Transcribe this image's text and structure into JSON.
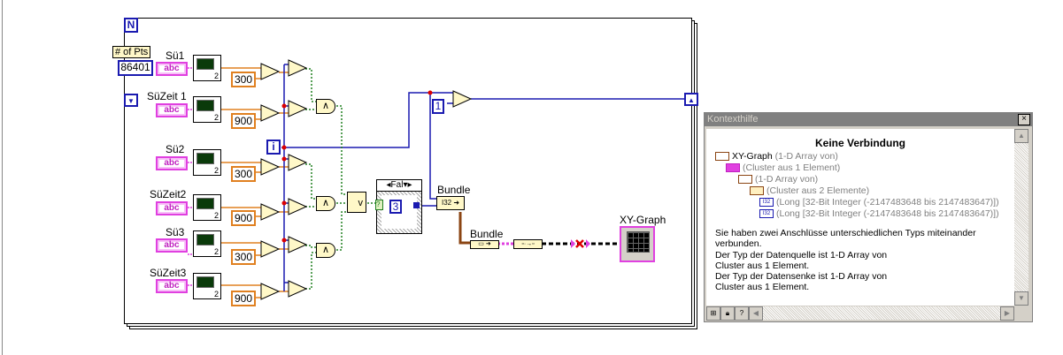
{
  "diagram": {
    "loop_count_terminal": "N",
    "iteration_terminal": "i",
    "num_points": {
      "label": "# of Pts",
      "value": "86401"
    },
    "rows": [
      {
        "label": "Sü1",
        "string_const": "abc",
        "subvi_num": "2",
        "offset": "300"
      },
      {
        "label": "SüZeit 1",
        "string_const": "abc",
        "subvi_num": "2",
        "offset": "900"
      },
      {
        "label": "Sü2",
        "string_const": "abc",
        "subvi_num": "2",
        "offset": "300"
      },
      {
        "label": "SüZeit2",
        "string_const": "abc",
        "subvi_num": "2",
        "offset": "900"
      },
      {
        "label": "Sü3",
        "string_const": "abc",
        "subvi_num": "2",
        "offset": "300"
      },
      {
        "label": "SüZeit3",
        "string_const": "abc",
        "subvi_num": "2",
        "offset": "900"
      }
    ],
    "add_symbol": "+",
    "and_symbol": "∧",
    "or_symbol": "v",
    "case_selector": "Fal",
    "case_constant": "3",
    "increment_constant": "1",
    "bundle1_label": "Bundle",
    "bundle2_label": "Bundle",
    "graph_label": "XY-Graph",
    "wire_colors": {
      "integer": "#1a1ab0",
      "double": "#e08020",
      "boolean": "#208020",
      "string": "#e040e0",
      "cluster": "#8b4513"
    }
  },
  "context_help": {
    "title": "Kontexthilfe",
    "heading": "Keine Verbindung",
    "tree": [
      {
        "name": "XY-Graph",
        "desc": "(1-D Array von)"
      },
      {
        "name": "",
        "desc": "(Cluster aus 1 Element)"
      },
      {
        "name": "",
        "desc": "(1-D Array von)"
      },
      {
        "name": "",
        "desc": "(Cluster aus 2 Elemente)"
      },
      {
        "name": "",
        "desc": "(Long [32-Bit Integer (-2147483648 bis 2147483647)])"
      },
      {
        "name": "",
        "desc": "(Long [32-Bit Integer (-2147483648 bis 2147483647)])"
      }
    ],
    "message": [
      "Sie haben zwei Anschlüsse unterschiedlichen Typs miteinander",
      "verbunden.",
      "Der Typ der Datenquelle ist 1-D Array von",
      "Cluster aus 1 Element.",
      "Der Typ der Datensenke ist 1-D Array von",
      "Cluster aus 1 Element."
    ]
  }
}
